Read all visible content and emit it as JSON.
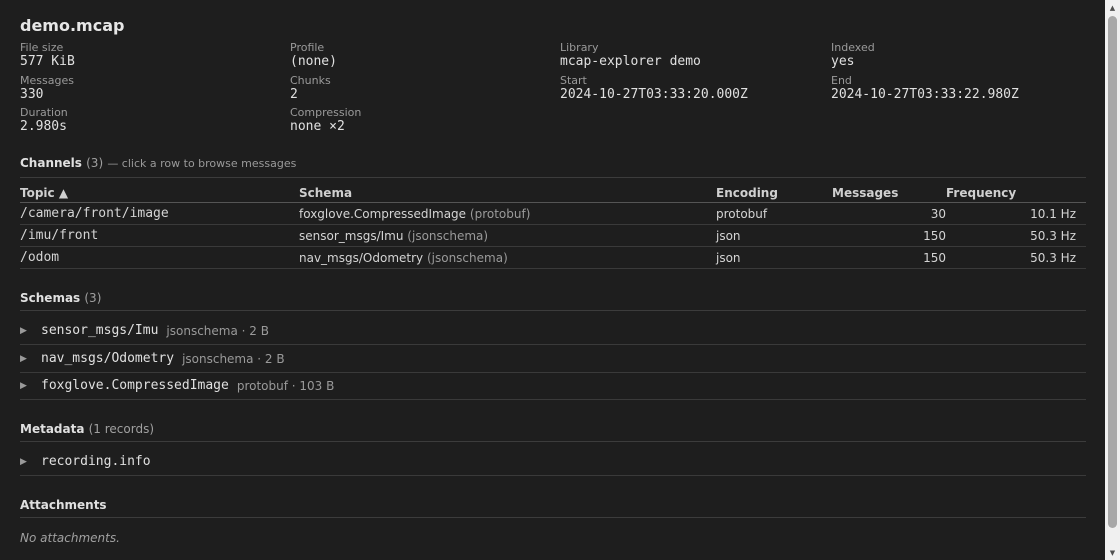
{
  "file": {
    "name": "demo.mcap"
  },
  "summary": {
    "file_size": {
      "label": "File size",
      "value": "577 KiB"
    },
    "profile": {
      "label": "Profile",
      "value": "(none)"
    },
    "library": {
      "label": "Library",
      "value": "mcap-explorer demo"
    },
    "indexed": {
      "label": "Indexed",
      "value": "yes"
    },
    "messages": {
      "label": "Messages",
      "value": "330"
    },
    "chunks": {
      "label": "Chunks",
      "value": "2"
    },
    "start": {
      "label": "Start",
      "value": "2024-10-27T03:33:20.000Z"
    },
    "end": {
      "label": "End",
      "value": "2024-10-27T03:33:22.980Z"
    },
    "duration": {
      "label": "Duration",
      "value": "2.980s"
    },
    "compression": {
      "label": "Compression",
      "value": "none ×2"
    }
  },
  "channels": {
    "title": "Channels",
    "count": "(3)",
    "hint": "— click a row to browse messages",
    "headers": {
      "topic": "Topic ▲",
      "schema": "Schema",
      "encoding": "Encoding",
      "messages": "Messages",
      "frequency": "Frequency"
    },
    "rows": [
      {
        "topic": "/camera/front/image",
        "schema": "foxglove.CompressedImage",
        "schema_enc": "(protobuf)",
        "encoding": "protobuf",
        "messages": "30",
        "frequency": "10.1 Hz"
      },
      {
        "topic": "/imu/front",
        "schema": "sensor_msgs/Imu",
        "schema_enc": "(jsonschema)",
        "encoding": "json",
        "messages": "150",
        "frequency": "50.3 Hz"
      },
      {
        "topic": "/odom",
        "schema": "nav_msgs/Odometry",
        "schema_enc": "(jsonschema)",
        "encoding": "json",
        "messages": "150",
        "frequency": "50.3 Hz"
      }
    ]
  },
  "schemas": {
    "title": "Schemas",
    "count": "(3)",
    "items": [
      {
        "name": "sensor_msgs/Imu",
        "meta": "jsonschema · 2 B"
      },
      {
        "name": "nav_msgs/Odometry",
        "meta": "jsonschema · 2 B"
      },
      {
        "name": "foxglove.CompressedImage",
        "meta": "protobuf · 103 B"
      }
    ]
  },
  "metadata": {
    "title": "Metadata",
    "count": "(1 records)",
    "items": [
      {
        "name": "recording.info"
      }
    ]
  },
  "attachments": {
    "title": "Attachments",
    "empty": "No attachments."
  },
  "icons": {
    "expand": "triangle-right-icon"
  }
}
